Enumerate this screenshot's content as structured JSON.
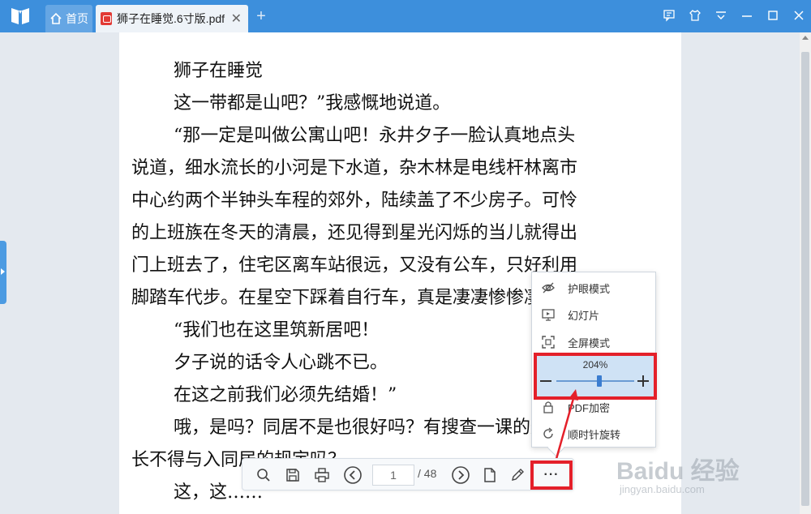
{
  "titlebar": {
    "home_tab": "首页",
    "doc_tab": "狮子在睡觉.6寸版.pdf",
    "close": "✕",
    "add": "+"
  },
  "document": {
    "lines": [
      {
        "text": "狮子在睡觉",
        "indent": true
      },
      {
        "text": "这一带都是山吧？”我感慨地说道。",
        "indent": true
      },
      {
        "text": "“那一定是叫做公寓山吧！永井夕子一脸认真地点头",
        "indent": true
      },
      {
        "text": "说道，细水流长的小河是下水道，杂木林是电线杆林离市",
        "indent": false
      },
      {
        "text": "中心约两个半钟头车程的郊外，陆续盖了不少房子。可怜",
        "indent": false
      },
      {
        "text": "的上班族在冬天的清晨，还见得到星光闪烁的当儿就得出",
        "indent": false
      },
      {
        "text": "门上班去了，住宅区离车站很远，又没有公车，只好利用",
        "indent": false
      },
      {
        "text": "脚踏车代步。在星空下踩着自行车，真是凄凄惨惨凄凄。",
        "indent": false
      },
      {
        "text": "“我们也在这里筑新居吧！",
        "indent": true
      },
      {
        "text": "夕子说的话令人心跳不已。",
        "indent": true
      },
      {
        "text": "在这之前我们必须先结婚！”",
        "indent": true
      },
      {
        "text": "哦，是吗？同居不是也很好吗？有搜查一课的刑事组",
        "indent": true
      },
      {
        "text": "长不得与入同居的规定吗？",
        "indent": false
      },
      {
        "text": "这，这……",
        "indent": true
      }
    ]
  },
  "toolbar": {
    "current_page": "1",
    "total_pages": "/ 48",
    "more": "···"
  },
  "popup": {
    "items": [
      {
        "label": "护眼模式",
        "icon": "eye-off-icon"
      },
      {
        "label": "幻灯片",
        "icon": "slideshow-icon"
      },
      {
        "label": "全屏模式",
        "icon": "fullscreen-icon"
      },
      {
        "label": "PDF加密",
        "icon": "lock-icon"
      },
      {
        "label": "顺时针旋转",
        "icon": "rotate-cw-icon"
      }
    ],
    "zoom": {
      "label": "204%",
      "level": 0.55
    }
  },
  "watermark": {
    "logo": "Baidu 经验",
    "url": "jingyan.baidu.com"
  },
  "colors": {
    "titlebar": "#3d8fdc",
    "highlight": "#e4202a",
    "zoom_bg": "#cfe2f5"
  }
}
